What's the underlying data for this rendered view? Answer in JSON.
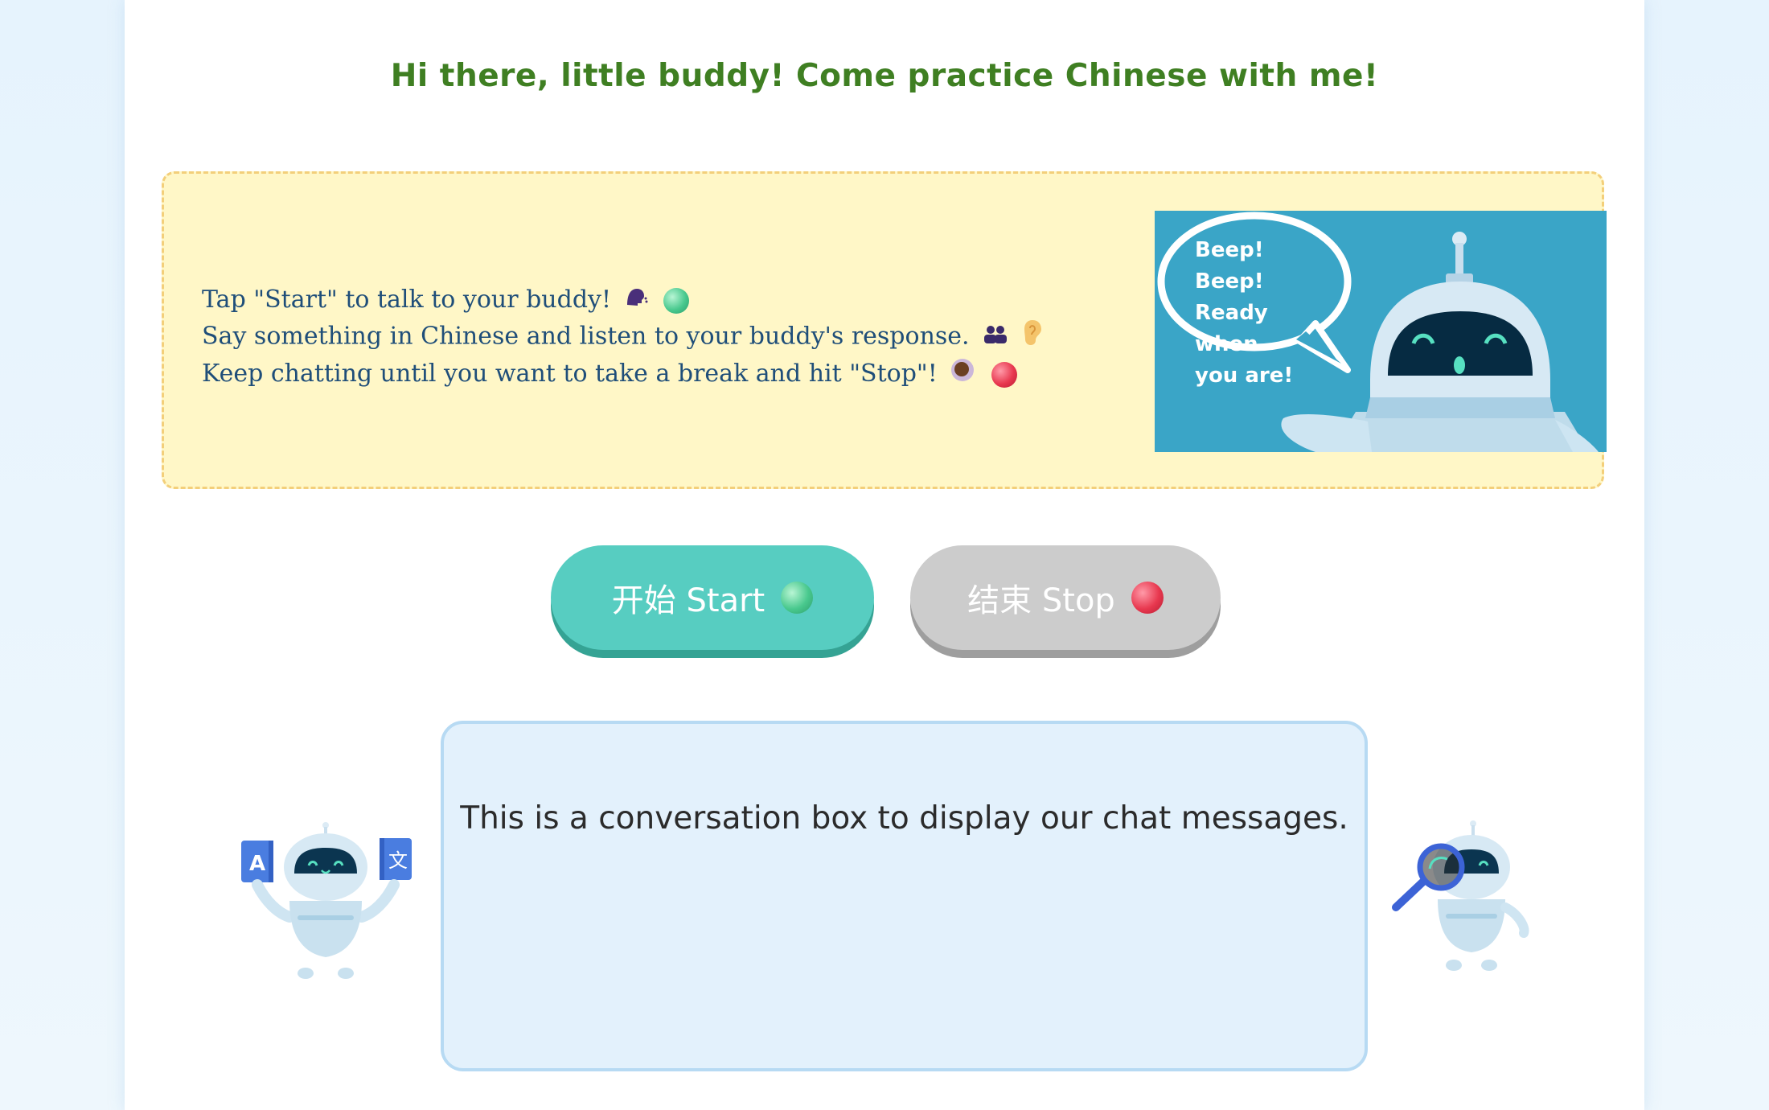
{
  "greeting": "Hi there, little buddy! Come practice Chinese with me!",
  "instructions": {
    "lines": [
      "Tap \"Start\" to talk to your buddy!",
      "Say something in Chinese and listen to your buddy's response.",
      "Keep chatting until you want to take a break and hit \"Stop\"!"
    ],
    "icons": [
      "speaking-head-icon",
      "green-circle-icon",
      "people-icon",
      "ear-icon",
      "coffee-icon",
      "red-circle-icon"
    ]
  },
  "banner": {
    "speech_line1": "Beep! Beep!",
    "speech_line2": "Ready when",
    "speech_line3": "you are!"
  },
  "buttons": {
    "start_label": "开始 Start",
    "stop_label": "结束 Stop"
  },
  "chat": {
    "message": "This is a conversation box to display our chat messages."
  },
  "colors": {
    "greeting": "#3f7f22",
    "instructions_bg": "#fff7c7",
    "instructions_text": "#1f4e79",
    "start_button": "#57cdc1",
    "stop_button": "#cccccc",
    "chat_bg": "#e3f1fc",
    "banner_bg": "#3aa5c7"
  }
}
